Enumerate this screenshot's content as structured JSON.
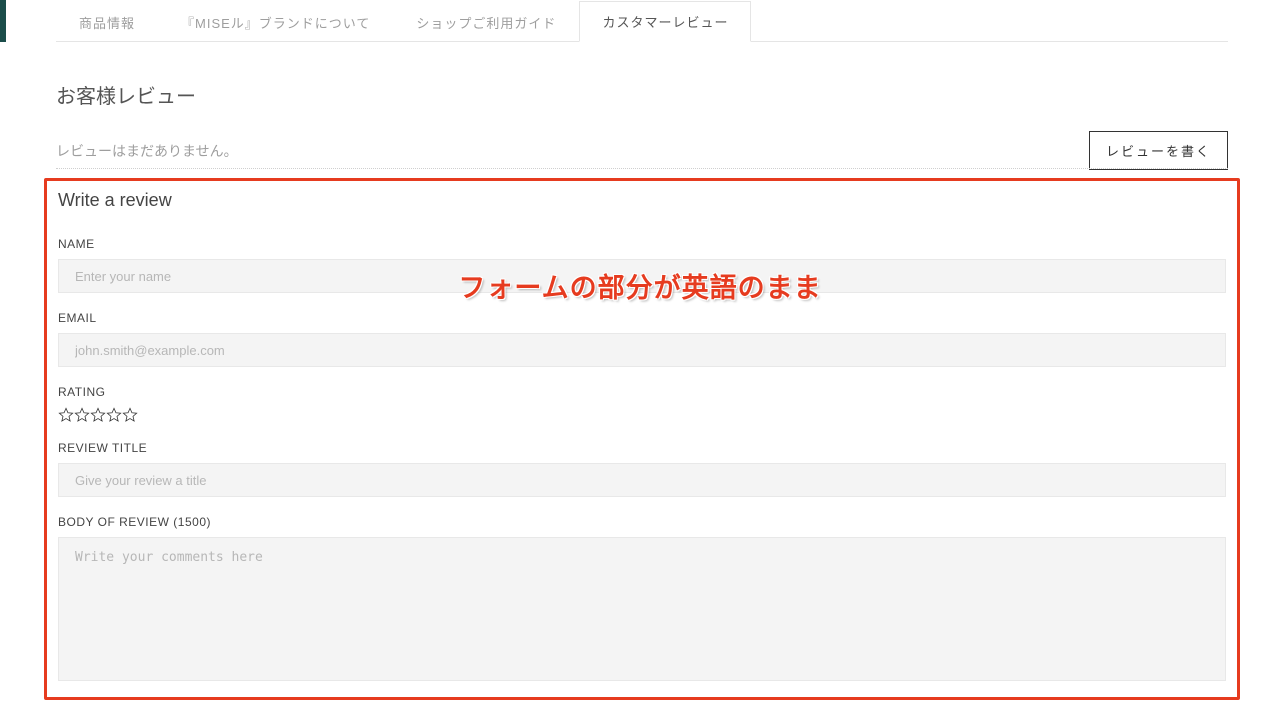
{
  "tabs": [
    {
      "label": "商品情報"
    },
    {
      "label": "『MISEル』ブランドについて"
    },
    {
      "label": "ショップご利用ガイド"
    },
    {
      "label": "カスタマーレビュー"
    }
  ],
  "reviewHeader": {
    "title": "お客様レビュー",
    "empty": "レビューはまだありません。",
    "writeBtn": "レビューを書く"
  },
  "overlay": "フォームの部分が英語のまま",
  "form": {
    "title": "Write a review",
    "nameLabel": "NAME",
    "namePlaceholder": "Enter your name",
    "emailLabel": "EMAIL",
    "emailPlaceholder": "john.smith@example.com",
    "ratingLabel": "RATING",
    "reviewTitleLabel": "REVIEW TITLE",
    "reviewTitlePlaceholder": "Give your review a title",
    "bodyLabel": "BODY OF REVIEW (1500)",
    "bodyPlaceholder": "Write your comments here"
  }
}
